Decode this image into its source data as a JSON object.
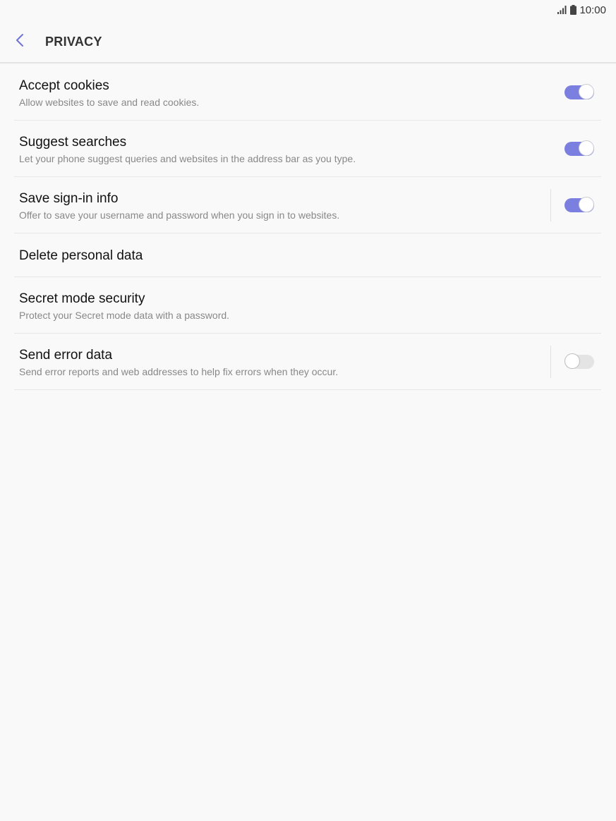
{
  "status_bar": {
    "time": "10:00",
    "icons": [
      "signal-icon",
      "battery-icon"
    ]
  },
  "header": {
    "title": "PRIVACY",
    "back_icon": "chevron-left-icon"
  },
  "colors": {
    "accent": "#7b7fe0",
    "switch_off": "#e4e4e4",
    "background": "#f9f9f9"
  },
  "items": [
    {
      "title": "Accept cookies",
      "summary": "Allow websites to save and read cookies.",
      "switch": true
    },
    {
      "title": "Suggest searches",
      "summary": "Let your phone suggest queries and websites in the address bar as you type.",
      "switch": true
    },
    {
      "title": "Save sign-in info",
      "summary": "Offer to save your username and password when you sign in to websites.",
      "switch": true
    },
    {
      "title": "Delete personal data"
    },
    {
      "title": "Secret mode security",
      "summary": "Protect your Secret mode data with a password."
    },
    {
      "title": "Send error data",
      "summary": "Send error reports and web addresses to help fix errors when they occur.",
      "switch": false
    }
  ]
}
